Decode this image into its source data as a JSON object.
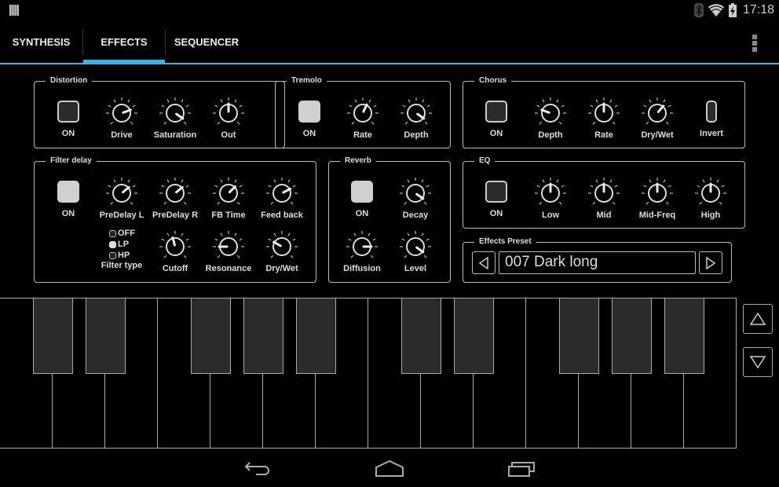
{
  "status_bar": {
    "notification_icon": "notification-bars-icon",
    "icons": [
      "bluetooth-icon",
      "wifi-icon",
      "battery-charging-icon"
    ],
    "time": "17:18"
  },
  "tabs": [
    {
      "label": "SYNTHESIS",
      "active": false
    },
    {
      "label": "EFFECTS",
      "active": true
    },
    {
      "label": "SEQUENCER",
      "active": false
    }
  ],
  "overflow_menu_icon": "overflow-menu-icon",
  "accent_color": "#33b5e5",
  "panels": {
    "distortion": {
      "title": "Distortion",
      "on_label": "ON",
      "on": false,
      "knobs": [
        {
          "label": "Drive",
          "value_deg": 70
        },
        {
          "label": "Saturation",
          "value_deg": 125
        },
        {
          "label": "Out",
          "value_deg": 0
        }
      ]
    },
    "tremolo": {
      "title": "Tremolo",
      "on_label": "ON",
      "on": true,
      "knobs": [
        {
          "label": "Rate",
          "value_deg": 25
        },
        {
          "label": "Depth",
          "value_deg": 125
        }
      ]
    },
    "chorus": {
      "title": "Chorus",
      "on_label": "ON",
      "on": false,
      "knobs": [
        {
          "label": "Depth",
          "value_deg": -70
        },
        {
          "label": "Rate",
          "value_deg": 0
        },
        {
          "label": "Dry/Wet",
          "value_deg": 40
        }
      ],
      "invert_label": "Invert",
      "invert": false
    },
    "filter_delay": {
      "title": "Filter delay",
      "on_label": "ON",
      "on": true,
      "knobs_top": [
        {
          "label": "PreDelay L",
          "value_deg": 50
        },
        {
          "label": "PreDelay R",
          "value_deg": 50
        },
        {
          "label": "FB Time",
          "value_deg": 45
        },
        {
          "label": "Feed back",
          "value_deg": 62
        }
      ],
      "filter_type": {
        "label": "Filter type",
        "options": [
          "OFF",
          "LP",
          "HP"
        ],
        "selected": "LP"
      },
      "knobs_bottom": [
        {
          "label": "Cutoff",
          "value_deg": -15
        },
        {
          "label": "Resonance",
          "value_deg": -90
        },
        {
          "label": "Dry/Wet",
          "value_deg": -60
        }
      ]
    },
    "reverb": {
      "title": "Reverb",
      "on_label": "ON",
      "on": true,
      "knobs": [
        {
          "label": "Decay",
          "value_deg": 125
        },
        {
          "label": "Diffusion",
          "value_deg": 90
        },
        {
          "label": "Level",
          "value_deg": 125
        }
      ]
    },
    "eq": {
      "title": "EQ",
      "on_label": "ON",
      "on": false,
      "knobs": [
        {
          "label": "Low",
          "value_deg": 0
        },
        {
          "label": "Mid",
          "value_deg": 0
        },
        {
          "label": "Mid-Freq",
          "value_deg": 0
        },
        {
          "label": "High",
          "value_deg": 0
        }
      ]
    },
    "effects_preset": {
      "title": "Effects Preset",
      "current": "007 Dark long",
      "prev_icon": "triangle-left-icon",
      "next_icon": "triangle-right-icon"
    }
  },
  "keyboard": {
    "white_keys": 14,
    "black_key_pattern": [
      1,
      1,
      0,
      1,
      1,
      1,
      0,
      1,
      1,
      0,
      1,
      1,
      1
    ],
    "octave_up_icon": "triangle-up-icon",
    "octave_down_icon": "triangle-down-icon"
  },
  "nav_bar": {
    "buttons": [
      "back-icon",
      "home-icon",
      "recent-apps-icon"
    ]
  }
}
